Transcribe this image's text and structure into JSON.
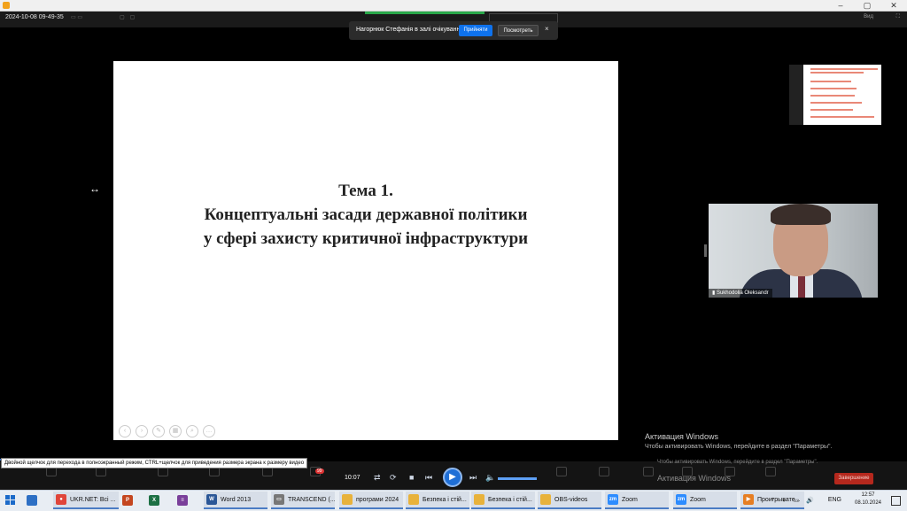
{
  "zoom_header": {
    "timestamp": "2024-10-08 09-49-35",
    "view": "Вид",
    "fullscreen": "⛶"
  },
  "waiting_notice": {
    "text": "Нагорнюк Стефанія в залі очікування",
    "admit": "Прийняти",
    "view": "Посмотреть",
    "close": "×"
  },
  "slide": {
    "line1": "Тема 1.",
    "line2": "Концептуальні засади державної політики",
    "line3": "у сфері захисту критичної інфраструктури"
  },
  "camera": {
    "name": "Sukhodolia Oleksandr"
  },
  "windows_activation": {
    "title": "Активация Windows",
    "text": "Чтобы активировать Windows, перейдите в раздел \"Параметры\"."
  },
  "player": {
    "tooltip": "Двойной щелчок для перехода в полноэкранный режим, CTRL+щелчок для приведения размера экрана к размеру видео",
    "time": "10:07",
    "progress_fraction": 0.08
  },
  "zoom_toolbar": {
    "end_button": "Завершение",
    "chat_badge": "99"
  },
  "taskbar": {
    "apps": [
      {
        "label": "",
        "name": "explorer-taskbar-button",
        "icon": "folder-icon",
        "color": "#2d6fc4"
      },
      {
        "label": "UKR.NET: Всі ...",
        "name": "chrome-taskbar-button",
        "icon": "chrome-icon",
        "color": "#e0453a"
      },
      {
        "label": "",
        "name": "powerpoint-taskbar-button",
        "icon": "powerpoint-icon",
        "color": "#c4461f"
      },
      {
        "label": "",
        "name": "excel-taskbar-button",
        "icon": "excel-icon",
        "color": "#1d7044"
      },
      {
        "label": "",
        "name": "winrar-taskbar-button",
        "icon": "winrar-icon",
        "color": "#7a3f9a"
      },
      {
        "label": "Word 2013",
        "name": "word-taskbar-button",
        "icon": "word-icon",
        "color": "#2b5797"
      },
      {
        "label": "TRANSCEND (...",
        "name": "transcend-taskbar-button",
        "icon": "drive-icon",
        "color": "#777777"
      },
      {
        "label": "програми 2024",
        "name": "folder-programs-taskbar-button",
        "icon": "folder-icon",
        "color": "#e8b23b"
      },
      {
        "label": "Безпека і стій...",
        "name": "folder-security1-taskbar-button",
        "icon": "folder-icon",
        "color": "#e8b23b"
      },
      {
        "label": "Безпека і стій...",
        "name": "folder-security2-taskbar-button",
        "icon": "folder-icon",
        "color": "#e8b23b"
      },
      {
        "label": "OBS-videos",
        "name": "folder-obs-taskbar-button",
        "icon": "folder-icon",
        "color": "#e8b23b"
      },
      {
        "label": "Zoom",
        "name": "zoom1-taskbar-button",
        "icon": "zoom-icon",
        "color": "#2d8cff"
      },
      {
        "label": "Zoom",
        "name": "zoom2-taskbar-button",
        "icon": "zoom-icon",
        "color": "#2d8cff"
      },
      {
        "label": "Проигрывате...",
        "name": "player-taskbar-button",
        "icon": "media-player-icon",
        "color": "#e67e22"
      }
    ],
    "language": "ENG",
    "time": "12:57",
    "date": "08.10.2024"
  }
}
